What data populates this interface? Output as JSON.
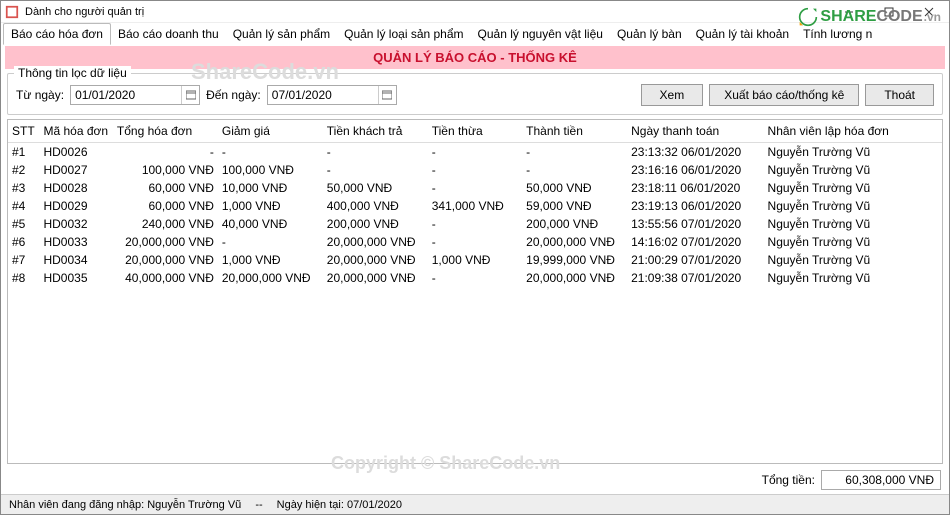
{
  "window": {
    "title": "Dành cho người quản trị"
  },
  "tabs": [
    "Báo cáo hóa đơn",
    "Báo cáo doanh thu",
    "Quản lý sản phẩm",
    "Quản lý loại sản phẩm",
    "Quản lý nguyên vật liệu",
    "Quản lý bàn",
    "Quản lý tài khoản",
    "Tính lương n"
  ],
  "banner": "QUẢN LÝ BÁO CÁO - THỐNG KÊ",
  "filter": {
    "legend": "Thông tin lọc dữ liệu",
    "from_label": "Từ ngày:",
    "from_value": "01/01/2020",
    "to_label": "Đến ngày:",
    "to_value": "07/01/2020"
  },
  "buttons": {
    "view": "Xem",
    "export": "Xuất báo cáo/thống kê",
    "exit": "Thoát"
  },
  "columns": {
    "stt": "STT",
    "id": "Mã hóa đơn",
    "tong": "Tổng hóa đơn",
    "giam": "Giảm giá",
    "khach": "Tiền khách trả",
    "thua": "Tiền thừa",
    "thanh": "Thành tiền",
    "ngay": "Ngày thanh toán",
    "nv": "Nhân viên lập hóa đơn"
  },
  "rows": [
    {
      "stt": "#1",
      "id": "HD0026",
      "tong": "-",
      "giam": "-",
      "khach": "-",
      "thua": "-",
      "thanh": "-",
      "ngay": "23:13:32 06/01/2020",
      "nv": "Nguyễn Trường Vũ"
    },
    {
      "stt": "#2",
      "id": "HD0027",
      "tong": "100,000 VNĐ",
      "giam": "100,000 VNĐ",
      "khach": "-",
      "thua": "-",
      "thanh": "-",
      "ngay": "23:16:16 06/01/2020",
      "nv": "Nguyễn Trường Vũ"
    },
    {
      "stt": "#3",
      "id": "HD0028",
      "tong": "60,000 VNĐ",
      "giam": "10,000 VNĐ",
      "khach": "50,000 VNĐ",
      "thua": "-",
      "thanh": "50,000 VNĐ",
      "ngay": "23:18:11 06/01/2020",
      "nv": "Nguyễn Trường Vũ"
    },
    {
      "stt": "#4",
      "id": "HD0029",
      "tong": "60,000 VNĐ",
      "giam": "1,000 VNĐ",
      "khach": "400,000 VNĐ",
      "thua": "341,000 VNĐ",
      "thanh": "59,000 VNĐ",
      "ngay": "23:19:13 06/01/2020",
      "nv": "Nguyễn Trường Vũ"
    },
    {
      "stt": "#5",
      "id": "HD0032",
      "tong": "240,000 VNĐ",
      "giam": "40,000 VNĐ",
      "khach": "200,000 VNĐ",
      "thua": "-",
      "thanh": "200,000 VNĐ",
      "ngay": "13:55:56 07/01/2020",
      "nv": "Nguyễn Trường Vũ"
    },
    {
      "stt": "#6",
      "id": "HD0033",
      "tong": "20,000,000 VNĐ",
      "giam": "-",
      "khach": "20,000,000 VNĐ",
      "thua": "-",
      "thanh": "20,000,000 VNĐ",
      "ngay": "14:16:02 07/01/2020",
      "nv": "Nguyễn Trường Vũ"
    },
    {
      "stt": "#7",
      "id": "HD0034",
      "tong": "20,000,000 VNĐ",
      "giam": "1,000 VNĐ",
      "khach": "20,000,000 VNĐ",
      "thua": "1,000 VNĐ",
      "thanh": "19,999,000 VNĐ",
      "ngay": "21:00:29 07/01/2020",
      "nv": "Nguyễn Trường Vũ"
    },
    {
      "stt": "#8",
      "id": "HD0035",
      "tong": "40,000,000 VNĐ",
      "giam": "20,000,000 VNĐ",
      "khach": "20,000,000 VNĐ",
      "thua": "-",
      "thanh": "20,000,000 VNĐ",
      "ngay": "21:09:38 07/01/2020",
      "nv": "Nguyễn Trường Vũ"
    }
  ],
  "total": {
    "label": "Tổng tiền:",
    "value": "60,308,000 VNĐ"
  },
  "status": {
    "user_label": "Nhân viên đang đăng nhập:",
    "user": "Nguyễn Trường Vũ",
    "date_label": "Ngày hiện tại:",
    "date": "07/01/2020"
  },
  "watermark": {
    "brand": "ShareCode.vn",
    "copyright": "Copyright © ShareCode.vn"
  },
  "logo": {
    "share": "SHARE",
    "code": "CODE",
    "vn": ".vn"
  }
}
